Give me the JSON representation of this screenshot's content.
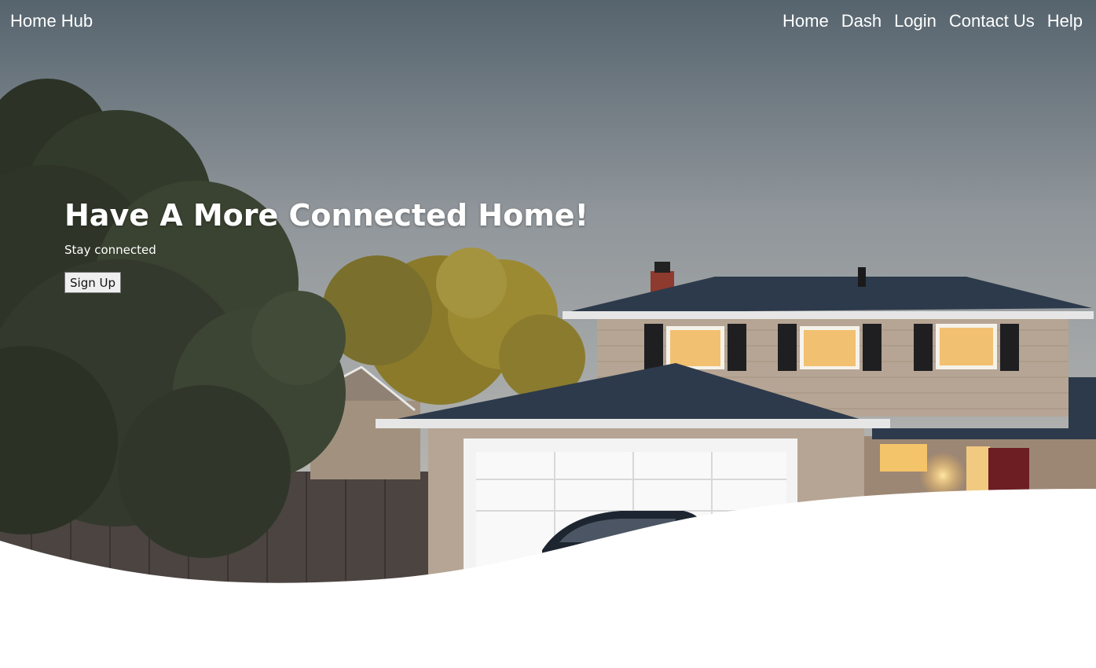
{
  "nav": {
    "brand": "Home Hub",
    "links": [
      "Home",
      "Dash",
      "Login",
      "Contact Us",
      "Help"
    ]
  },
  "hero": {
    "headline": "Have A More Connected Home!",
    "tagline": "Stay connected",
    "cta_label": "Sign Up"
  },
  "colors": {
    "sky_top": "#56646e",
    "sky_mid": "#8f959a",
    "sky_bottom": "#c6c4bd",
    "roof": "#2d3a4b",
    "siding": "#b6a594",
    "wave": "#ffffff"
  }
}
